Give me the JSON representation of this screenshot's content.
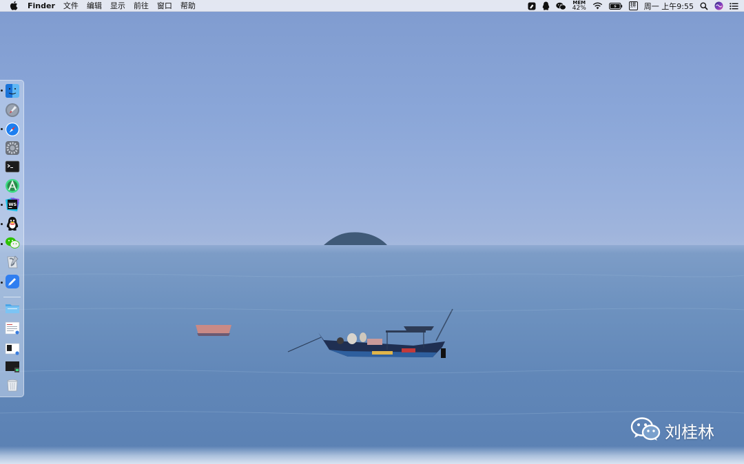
{
  "menubar": {
    "apple_icon": "apple-icon",
    "app_name": "Finder",
    "menus": [
      "文件",
      "编辑",
      "显示",
      "前往",
      "窗口",
      "帮助"
    ],
    "status": {
      "mem_label": "MEM",
      "mem_value": "42%",
      "input_method": "拼",
      "clock": "周一 上午9:55",
      "icons": [
        "notes-app-icon",
        "qq-status-icon",
        "wechat-status-icon",
        "memory-monitor-icon",
        "wifi-icon",
        "battery-icon",
        "input-method-icon",
        "spotlight-search-icon",
        "siri-icon",
        "notification-center-icon"
      ]
    }
  },
  "dock": {
    "apps": [
      {
        "name": "Finder",
        "icon": "finder-icon",
        "running": true
      },
      {
        "name": "Launchpad",
        "icon": "launchpad-icon",
        "running": false
      },
      {
        "name": "Safari",
        "icon": "safari-icon",
        "running": true
      },
      {
        "name": "System Preferences",
        "icon": "system-preferences-icon",
        "running": false
      },
      {
        "name": "Terminal",
        "icon": "terminal-icon",
        "running": false
      },
      {
        "name": "Android Studio",
        "icon": "android-studio-icon",
        "running": false
      },
      {
        "name": "WebStorm",
        "icon": "webstorm-icon",
        "running": true
      },
      {
        "name": "QQ",
        "icon": "qq-icon",
        "running": true
      },
      {
        "name": "WeChat",
        "icon": "wechat-icon",
        "running": true
      },
      {
        "name": "Script Editor",
        "icon": "script-editor-icon",
        "running": false
      },
      {
        "name": "Feishu",
        "icon": "feishu-icon",
        "running": true
      }
    ],
    "stacks": [
      {
        "name": "Folder",
        "icon": "folder-stack-icon"
      },
      {
        "name": "Document",
        "icon": "document-stack-icon"
      },
      {
        "name": "Screenshot",
        "icon": "screenshot-stack-icon"
      },
      {
        "name": "Downloads",
        "icon": "downloads-stack-icon"
      },
      {
        "name": "Trash",
        "icon": "trash-icon"
      }
    ]
  },
  "watermark": {
    "text": "刘桂林",
    "icon": "wechat-logo-icon"
  },
  "colors": {
    "sky": "#8aa6d8",
    "sea": "#6187b8",
    "menubar": "#eceef4",
    "dock": "#c8d8f0",
    "safari_blue": "#1e7ff0",
    "wechat_green": "#2dc100"
  }
}
